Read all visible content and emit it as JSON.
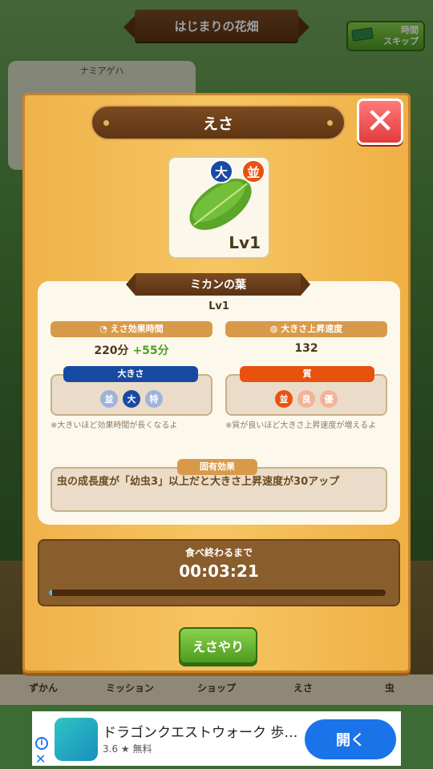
{
  "header": {
    "title": "はじまりの花畑",
    "time_skip_line1": "時間",
    "time_skip_line2": "スキップ"
  },
  "side_card": {
    "name": "ナミアゲハ"
  },
  "modal": {
    "title": "えさ",
    "item": {
      "level_badge": "Lv1",
      "size_badge": "大",
      "quality_badge": "並",
      "name": "ミカンの葉",
      "level": "Lv1"
    },
    "stats": {
      "duration_label": "えさ効果時間",
      "duration_value": "220分",
      "duration_bonus": "+55分",
      "speed_label": "大きさ上昇速度",
      "speed_value": "132"
    },
    "size": {
      "label": "大きさ",
      "options": [
        "並",
        "大",
        "特"
      ],
      "note": "※大きいほど効果時間が長くなるよ"
    },
    "quality": {
      "label": "質",
      "options": [
        "並",
        "良",
        "優"
      ],
      "note": "※質が良いほど大きさ上昇速度が増えるよ"
    },
    "effect": {
      "label": "固有効果",
      "text": "虫の成長度が「幼虫3」以上だと大きさ上昇速度が30アップ"
    },
    "timer": {
      "label": "食べ終わるまで",
      "value": "00:03:21",
      "progress": 0.01
    },
    "feed_button": "えさやり"
  },
  "bottom_nav": {
    "items": [
      "ずかん",
      "ミッション",
      "ショップ",
      "えさ",
      "虫"
    ]
  },
  "ad": {
    "title": "ドラゴンクエストウォーク 歩…",
    "rating": "3.6 ★ 無料",
    "open_label": "開く"
  },
  "colors": {
    "size_blue": "#174aa3",
    "quality_orange": "#e8520f",
    "green_button": "#4e9b22",
    "bonus_green": "#4ba02a",
    "ad_blue": "#1a73e8"
  }
}
